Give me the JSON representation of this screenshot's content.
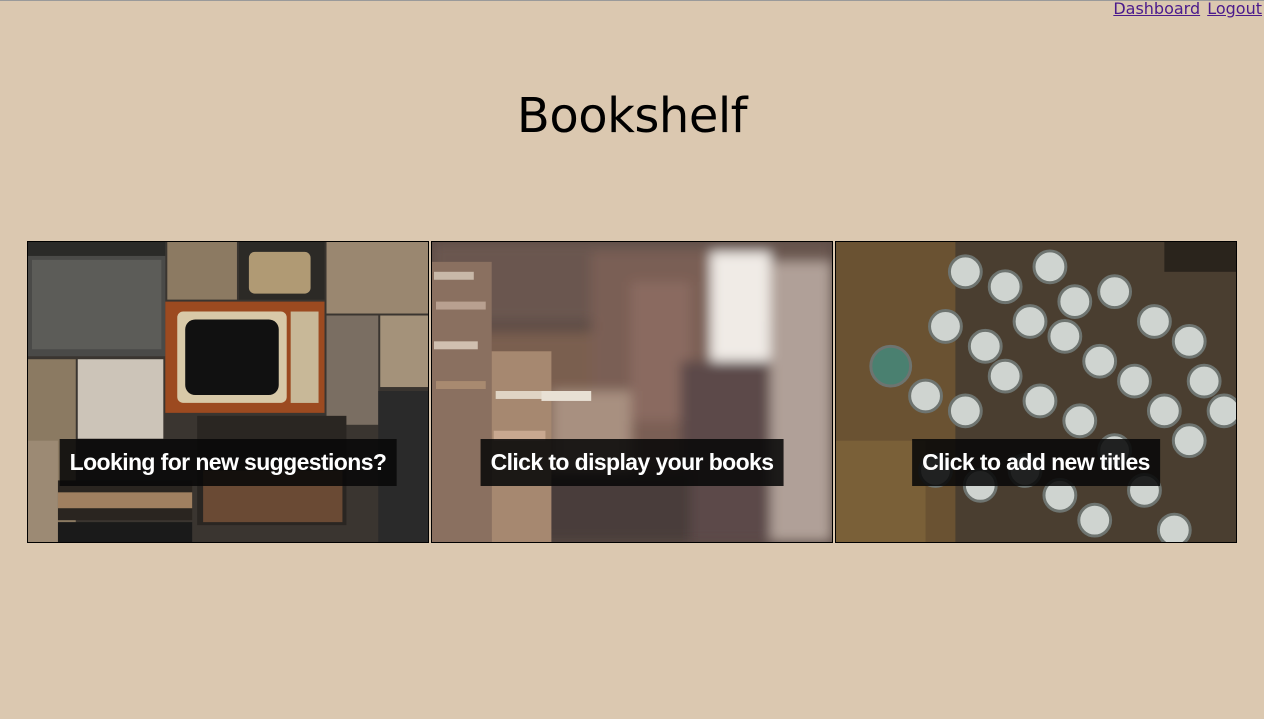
{
  "nav": {
    "dashboard": "Dashboard",
    "logout": "Logout"
  },
  "page": {
    "title": "Bookshelf"
  },
  "cards": [
    {
      "caption": "Looking for new suggestions?"
    },
    {
      "caption": "Click to display your books"
    },
    {
      "caption": "Click to add new titles"
    }
  ],
  "colors": {
    "background": "#dbc8b0",
    "link": "#4a1a8c",
    "caption_bg": "#080808"
  }
}
